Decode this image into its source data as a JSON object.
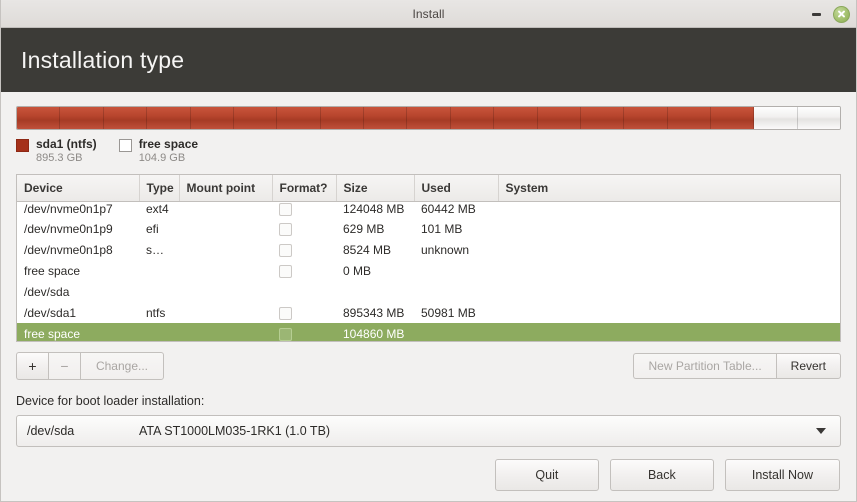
{
  "window": {
    "title": "Install",
    "minimize_label": "Minimize",
    "close_label": "Close"
  },
  "header": {
    "title": "Installation type"
  },
  "usage": {
    "segments": [
      {
        "name": "sda1 (ntfs)",
        "size_label": "895.3 GB",
        "percent": 89.5,
        "kind": "used",
        "color": "#a5311a"
      },
      {
        "name": "free space",
        "size_label": "104.9 GB",
        "percent": 10.5,
        "kind": "free",
        "color": "#ffffff"
      }
    ],
    "legend": [
      {
        "name": "sda1 (ntfs)",
        "size_label": "895.3 GB"
      },
      {
        "name": "free space",
        "size_label": "104.9 GB"
      }
    ]
  },
  "table": {
    "columns": [
      "Device",
      "Type",
      "Mount point",
      "Format?",
      "Size",
      "Used",
      "System"
    ],
    "rows": [
      {
        "device": "/dev/nvme0n1p7",
        "type": "ext4",
        "mount": "",
        "format": true,
        "size": "124048 MB",
        "used": "60442 MB",
        "system": "",
        "indent": true,
        "selected": false,
        "is_disk": false,
        "clipped": true
      },
      {
        "device": "/dev/nvme0n1p9",
        "type": "efi",
        "mount": "",
        "format": true,
        "size": "629 MB",
        "used": "101 MB",
        "system": "",
        "indent": true,
        "selected": false,
        "is_disk": false,
        "clipped": false
      },
      {
        "device": "/dev/nvme0n1p8",
        "type": "swap",
        "mount": "",
        "format": true,
        "size": "8524 MB",
        "used": "unknown",
        "system": "",
        "indent": true,
        "selected": false,
        "is_disk": false,
        "clipped": false
      },
      {
        "device": "free space",
        "type": "",
        "mount": "",
        "format": true,
        "size": "0 MB",
        "used": "",
        "system": "",
        "indent": true,
        "selected": false,
        "is_disk": false,
        "clipped": false
      },
      {
        "device": "/dev/sda",
        "type": "",
        "mount": "",
        "format": false,
        "size": "",
        "used": "",
        "system": "",
        "indent": false,
        "selected": false,
        "is_disk": true,
        "clipped": false
      },
      {
        "device": "/dev/sda1",
        "type": "ntfs",
        "mount": "",
        "format": true,
        "size": "895343 MB",
        "used": "50981 MB",
        "system": "",
        "indent": true,
        "selected": false,
        "is_disk": false,
        "clipped": false
      },
      {
        "device": "free space",
        "type": "",
        "mount": "",
        "format": true,
        "size": "104860 MB",
        "used": "",
        "system": "",
        "indent": true,
        "selected": true,
        "is_disk": false,
        "clipped": false
      }
    ],
    "selection_color": "#8dab5f"
  },
  "part_toolbar": {
    "add_label": "+",
    "remove_label": "−",
    "change_label": "Change...",
    "new_partition_table_label": "New Partition Table...",
    "revert_label": "Revert",
    "add_enabled": true,
    "remove_enabled": false,
    "change_enabled": false,
    "new_partition_table_enabled": false,
    "revert_enabled": true
  },
  "bootloader": {
    "label": "Device for boot loader installation:",
    "selected_device": "/dev/sda",
    "selected_description": "ATA ST1000LM035-1RK1 (1.0 TB)"
  },
  "footer": {
    "quit_label": "Quit",
    "back_label": "Back",
    "install_label": "Install Now"
  }
}
